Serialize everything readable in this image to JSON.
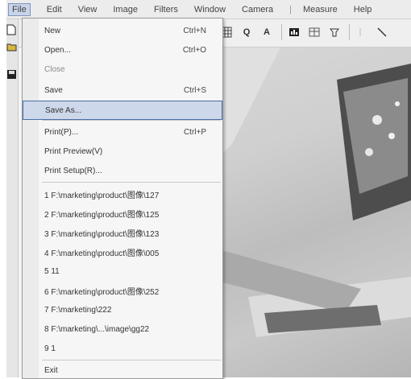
{
  "menubar": {
    "items": [
      "File",
      "Edit",
      "View",
      "Image",
      "Filters",
      "Window",
      "Camera",
      "Measure",
      "Help"
    ],
    "separator": "|"
  },
  "toolbar": {
    "zoom_icon_label": "Q",
    "text_tool_label": "A"
  },
  "file_menu": {
    "items": [
      {
        "label": "New",
        "shortcut": "Ctrl+N"
      },
      {
        "label": "Open...",
        "shortcut": "Ctrl+O"
      },
      {
        "label": "Close",
        "shortcut": ""
      },
      {
        "label": "Save",
        "shortcut": "Ctrl+S"
      },
      {
        "label": "Save As...",
        "shortcut": ""
      },
      {
        "label": "Print(P)...",
        "shortcut": "Ctrl+P"
      },
      {
        "label": "Print Preview(V)",
        "shortcut": ""
      },
      {
        "label": "Print Setup(R)...",
        "shortcut": ""
      },
      {
        "label": "1 F:\\marketing\\product\\图像\\127",
        "shortcut": ""
      },
      {
        "label": "2 F:\\marketing\\product\\图像\\125",
        "shortcut": ""
      },
      {
        "label": "3 F:\\marketing\\product\\图像\\123",
        "shortcut": ""
      },
      {
        "label": "4 F:\\marketing\\product\\图像\\005",
        "shortcut": ""
      },
      {
        "label": "5 11",
        "shortcut": ""
      },
      {
        "label": "6 F:\\marketing\\product\\图像\\252",
        "shortcut": ""
      },
      {
        "label": "7 F:\\marketing\\222",
        "shortcut": ""
      },
      {
        "label": "8 F:\\marketing\\...\\image\\gg22",
        "shortcut": ""
      },
      {
        "label": "9 1",
        "shortcut": ""
      },
      {
        "label": "Exit",
        "shortcut": ""
      }
    ]
  },
  "colors": {
    "highlight_bg": "#cdd8ea",
    "highlight_border": "#4a6fa8",
    "menu_bg": "#f6f6f6"
  }
}
